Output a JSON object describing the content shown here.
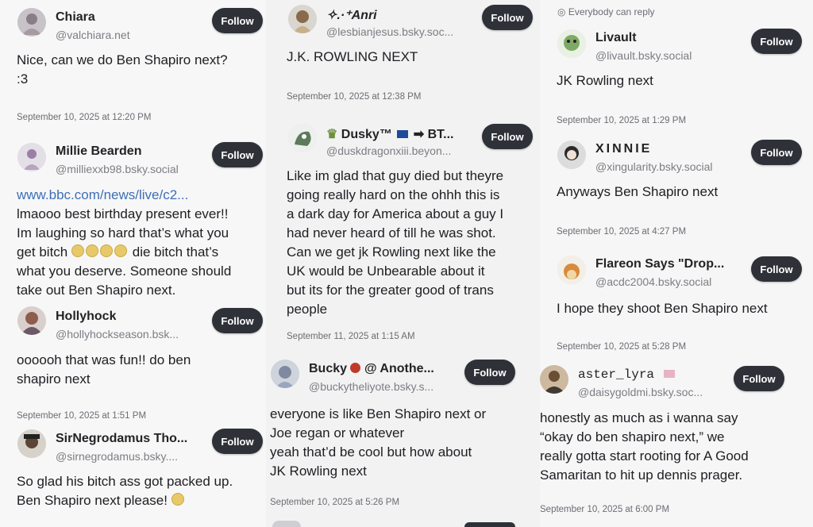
{
  "notice": {
    "icon": "globe-icon",
    "text": "Everybody can reply"
  },
  "follow_label": "Follow",
  "col1": [
    {
      "name": "Chiara",
      "handle": "@valchiara.net",
      "lines": [
        "Nice, can we do Ben Shapiro next?",
        ":3"
      ],
      "date": "September 10, 2025 at 12:20 PM"
    },
    {
      "name": "Millie Bearden",
      "handle": "@milliexxb98.bsky.social",
      "link": "www.bbc.com/news/live/c2...",
      "lines": [
        "lmaooo best birthday present ever!!",
        "Im laughing so hard that’s what you",
        "get bitch",
        "die bitch that’s",
        "what you deserve. Someone should",
        "take out Ben Shapiro next."
      ]
    },
    {
      "name": "Hollyhock",
      "handle": "@hollyhockseason.bsk...",
      "lines": [
        "oooooh that was fun!! do ben",
        "shapiro next"
      ],
      "date": "September 10, 2025 at 1:51 PM"
    },
    {
      "name": "SirNegrodamus Tho...",
      "handle": "@sirnegrodamus.bsky....",
      "lines": [
        "So glad his bitch ass got packed up.",
        "Ben Shapiro next please!"
      ]
    }
  ],
  "col2": [
    {
      "name": "✧.·⁺Anri",
      "handle": "@lesbianjesus.bsky.soc...",
      "lines": [
        "J.K. ROWLING NEXT"
      ],
      "date": "September 10, 2025 at 12:38 PM"
    },
    {
      "name": "Dusky™",
      "name_suffix": "BT...",
      "handle": "@duskdragonxiii.beyon...",
      "lines": [
        "Like im glad that guy died but theyre",
        "going really hard on the ohhh this is",
        "a dark day for America about a guy I",
        "had never heard of till he was shot.",
        "Can we get jk Rowling next like the",
        "UK would be Unbearable about it",
        "but its for the greater good of trans",
        "people"
      ],
      "date": "September 11, 2025 at 1:15 AM"
    },
    {
      "name": "Bucky",
      "name_suffix": "@ Anothe...",
      "handle": "@buckytheliyote.bsky.s...",
      "lines": [
        "everyone is like Ben Shapiro next or",
        "Joe regan or whatever",
        "yeah that’d be cool but how about",
        "JK Rowling next"
      ],
      "date": "September 10, 2025 at 5:26 PM"
    }
  ],
  "col3": [
    {
      "name": "Livault",
      "handle": "@livault.bsky.social",
      "lines": [
        "JK Rowling next"
      ],
      "date": "September 10, 2025 at 1:29 PM"
    },
    {
      "name": "XINNIE",
      "handle": "@xingularity.bsky.social",
      "lines": [
        "Anyways Ben Shapiro next"
      ],
      "date": "September 10, 2025 at 4:27 PM"
    },
    {
      "name": "Flareon Says \"Drop...",
      "handle": "@acdc2004.bsky.social",
      "lines": [
        "I hope they shoot Ben Shapiro next"
      ],
      "date": "September 10, 2025 at 5:28 PM"
    },
    {
      "name": "aster_lyra",
      "handle": "@daisygoldmi.bsky.soc...",
      "lines": [
        "honestly as much as i wanna say",
        "“okay do ben shapiro next,” we",
        "really gotta start rooting for A Good",
        "Samaritan to hit up dennis prager."
      ],
      "date": "September 10, 2025 at 6:00 PM"
    }
  ]
}
